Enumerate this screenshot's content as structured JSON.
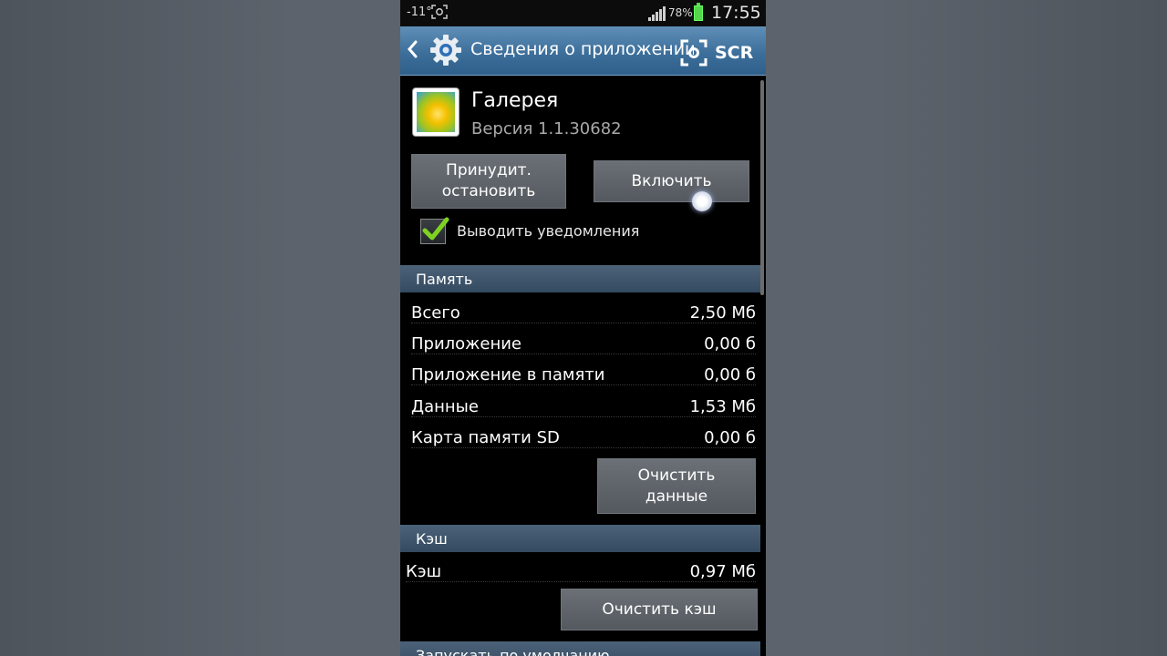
{
  "status_bar": {
    "temperature": "-11°",
    "battery_percent": "78%",
    "time": "17:55"
  },
  "action_bar": {
    "title": "Сведения о приложении",
    "scr_label": "SCR"
  },
  "app": {
    "name": "Галерея",
    "version": "Версия 1.1.30682"
  },
  "buttons": {
    "force_stop": "Принудит.\nостановить",
    "enable": "Включить",
    "clear_data": "Очистить\nданные",
    "clear_cache": "Очистить кэш"
  },
  "notifications": {
    "label": "Выводить уведомления",
    "checked": true
  },
  "memory": {
    "header": "Память",
    "rows": [
      {
        "label": "Всего",
        "value": "2,50 Мб"
      },
      {
        "label": "Приложение",
        "value": "0,00 б"
      },
      {
        "label": "Приложение в памяти",
        "value": "0,00 б"
      },
      {
        "label": "Данные",
        "value": "1,53 Мб"
      },
      {
        "label": "Карта памяти SD",
        "value": "0,00 б"
      }
    ]
  },
  "cache": {
    "header": "Кэш",
    "label": "Кэш",
    "value": "0,97 Мб"
  },
  "default_launch": {
    "header": "Запускать по умолчанию"
  },
  "colors": {
    "action_bar": "#3d6f9b",
    "section_header": "#40566c",
    "button": "#5e6369",
    "check_green": "#7ed321"
  }
}
